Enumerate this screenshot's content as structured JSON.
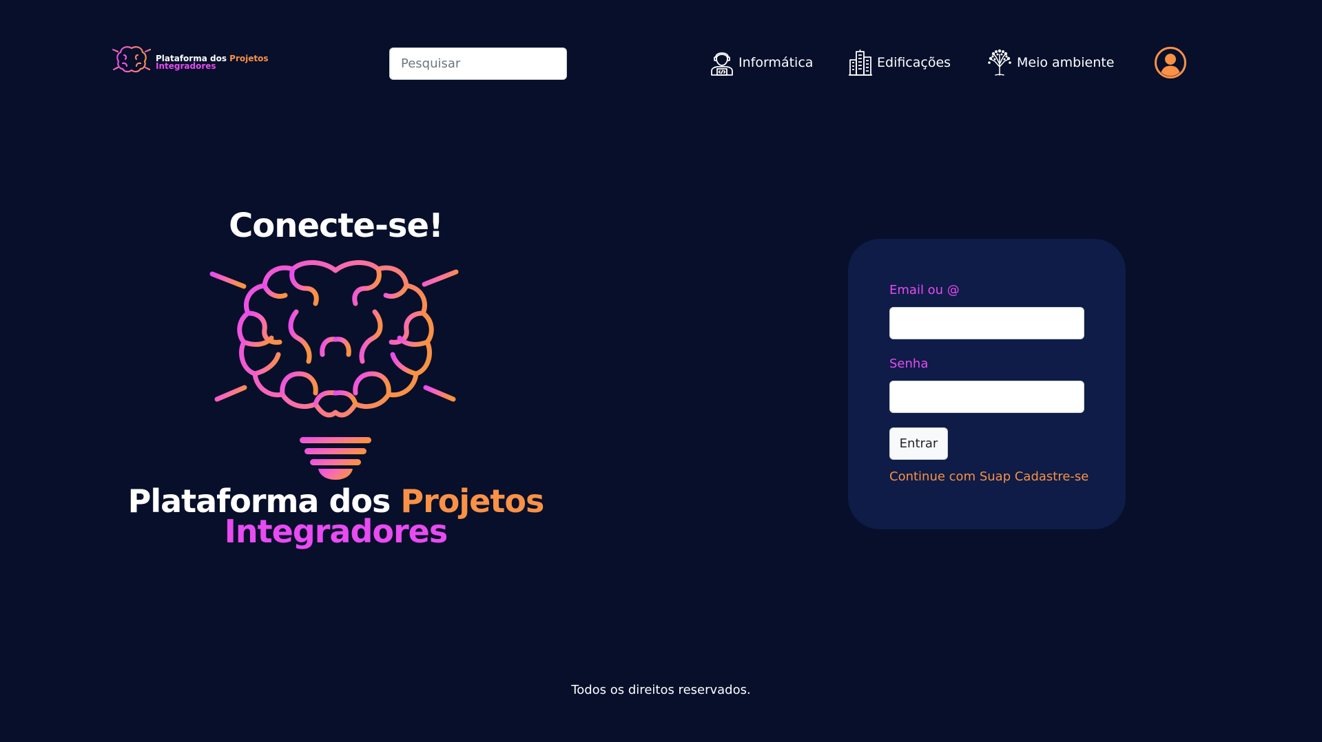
{
  "header": {
    "logo": {
      "line1_white": "Plataforma dos",
      "line1_accent": "Projetos",
      "line2": "Integradores"
    },
    "search": {
      "placeholder": "Pesquisar",
      "value": ""
    },
    "nav": [
      {
        "label": "Informática",
        "icon": "programmer-icon"
      },
      {
        "label": "Edificações",
        "icon": "buildings-icon"
      },
      {
        "label": "Meio ambiente",
        "icon": "tree-icon"
      }
    ],
    "avatar_icon": "user-icon"
  },
  "hero": {
    "title": "Conecte-se!",
    "brand_white": "Plataforma dos",
    "brand_accent": "Projetos",
    "brand_line2": "Integradores",
    "illustration_icon": "brain-lightbulb-icon"
  },
  "login": {
    "email_label": "Email ou @",
    "email_value": "",
    "password_label": "Senha",
    "password_value": "",
    "submit_label": "Entrar",
    "suap_link": "Continue com Suap",
    "register_link": "Cadastre-se"
  },
  "footer": {
    "text": "Todos os direitos reservados."
  },
  "colors": {
    "background": "#070f2b",
    "card": "#0e1c47",
    "accent_orange": "#f99146",
    "accent_pink": "#e84bf1"
  }
}
